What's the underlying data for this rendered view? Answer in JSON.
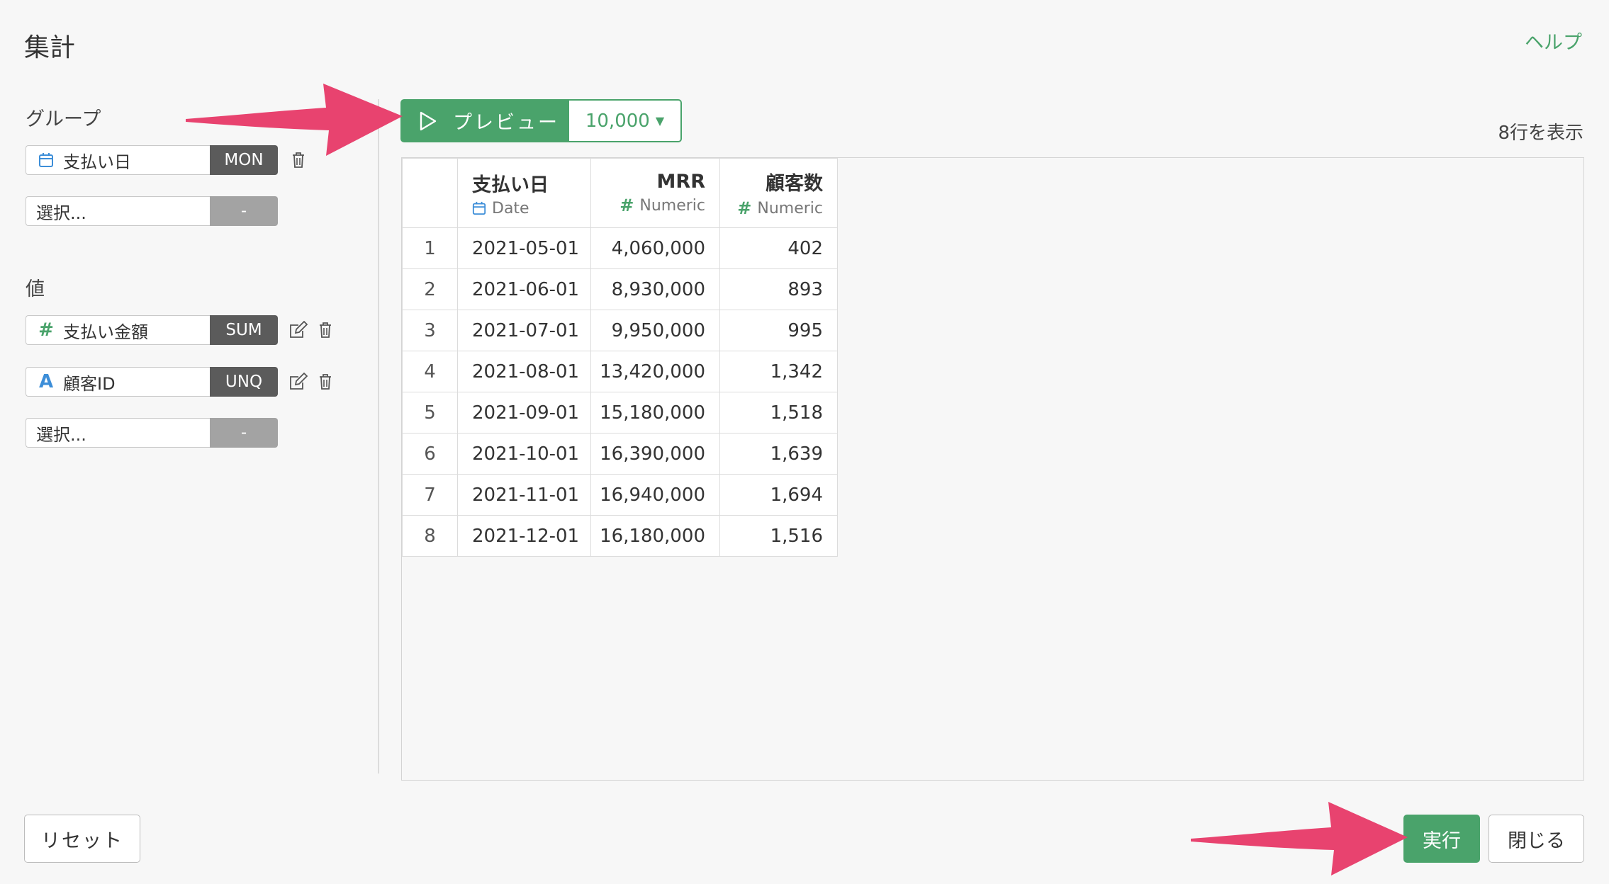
{
  "header": {
    "title": "集計",
    "help": "ヘルプ"
  },
  "group_section": {
    "label": "グループ",
    "items": [
      {
        "field": "支払い日",
        "icon": "calendar-icon",
        "aggregation": "MON"
      }
    ],
    "empty_select": {
      "placeholder": "選択...",
      "aggregation": "-"
    }
  },
  "value_section": {
    "label": "値",
    "items": [
      {
        "field": "支払い金額",
        "icon": "hash-icon",
        "aggregation": "SUM"
      },
      {
        "field": "顧客ID",
        "icon": "text-type-icon",
        "aggregation": "UNQ"
      }
    ],
    "empty_select": {
      "placeholder": "選択...",
      "aggregation": "-"
    }
  },
  "preview": {
    "button_label": "プレビュー",
    "row_limit": "10,000",
    "rows_shown": "8行を表示"
  },
  "table": {
    "columns": [
      {
        "name": "支払い日",
        "type": "Date",
        "type_icon": "calendar-icon"
      },
      {
        "name": "MRR",
        "type": "Numeric",
        "type_icon": "#"
      },
      {
        "name": "顧客数",
        "type": "Numeric",
        "type_icon": "#"
      }
    ],
    "rows": [
      [
        "1",
        "2021-05-01",
        "4,060,000",
        "402"
      ],
      [
        "2",
        "2021-06-01",
        "8,930,000",
        "893"
      ],
      [
        "3",
        "2021-07-01",
        "9,950,000",
        "995"
      ],
      [
        "4",
        "2021-08-01",
        "13,420,000",
        "1,342"
      ],
      [
        "5",
        "2021-09-01",
        "15,180,000",
        "1,518"
      ],
      [
        "6",
        "2021-10-01",
        "16,390,000",
        "1,639"
      ],
      [
        "7",
        "2021-11-01",
        "16,940,000",
        "1,694"
      ],
      [
        "8",
        "2021-12-01",
        "16,180,000",
        "1,516"
      ]
    ]
  },
  "footer": {
    "reset": "リセット",
    "run": "実行",
    "close": "閉じる"
  },
  "colors": {
    "accent": "#4aa36b",
    "aggregation_bg": "#5b5b5b",
    "arrow": "#e8436f",
    "calendar_icon": "#3d8ed8"
  }
}
